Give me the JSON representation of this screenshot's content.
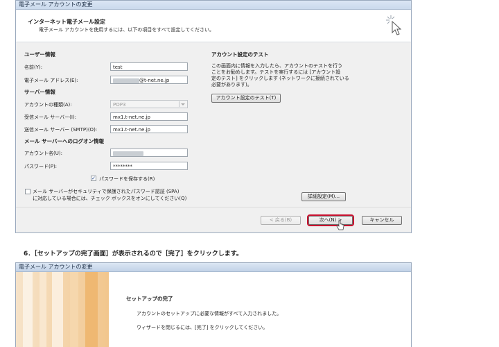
{
  "window1": {
    "title": "電子メール アカウントの変更",
    "header_title": "インターネット電子メール設定",
    "header_subtitle": "電子メール アカウントを使用するには、以下の項目をすべて設定してください。",
    "user_section": "ユーザー情報",
    "name_label": "名前(Y):",
    "name_value": "test",
    "email_label": "電子メール アドレス(E):",
    "email_value": "@t-net.ne.jp",
    "server_section": "サーバー情報",
    "account_type_label": "アカウントの種類(A):",
    "account_type_value": "POP3",
    "incoming_label": "受信メール サーバー(I):",
    "incoming_value": "mx1.t-net.ne.jp",
    "outgoing_label": "送信メール サーバー (SMTP)(O):",
    "outgoing_value": "mx1.t-net.ne.jp",
    "logon_section": "メール サーバーへのログオン情報",
    "account_name_label": "アカウント名(U):",
    "password_label": "パスワード(P):",
    "password_value": "********",
    "save_password_label": "パスワードを保存する(R)",
    "spa_line1": "メール サーバーがセキュリティで保護されたパスワード認証 (SPA)",
    "spa_line2": "に対応している場合には、チェック ボックスをオンにしてください(Q)",
    "test_section": "アカウント設定のテスト",
    "test_desc": [
      "この画面内に情報を入力したら、アカウントのテストを行う",
      "ことをお勧めします。テストを実行するには [アカウント設",
      "定のテスト] をクリックします (ネットワークに接続されている",
      "必要があります)。"
    ],
    "test_button": "アカウント設定のテスト(T)",
    "advanced_button": "詳細設定(M)...",
    "back_button": "< 戻る(B)",
    "next_button": "次へ(N) >",
    "cancel_button": "キャンセル"
  },
  "caption": "6．［セットアップの完了画面］が表示されるので［完了］をクリックします。",
  "window2": {
    "title": "電子メール アカウントの変更",
    "heading": "セットアップの完了",
    "line1": "アカウントのセットアップに必要な情報がすべて入力されました。",
    "line2": "ウィザードを閉じるには、[完了] をクリックしてください。"
  },
  "colors": {
    "titlebar": "#cad9ec",
    "highlight": "#c8102e",
    "art_orange": "#f2c68d"
  }
}
